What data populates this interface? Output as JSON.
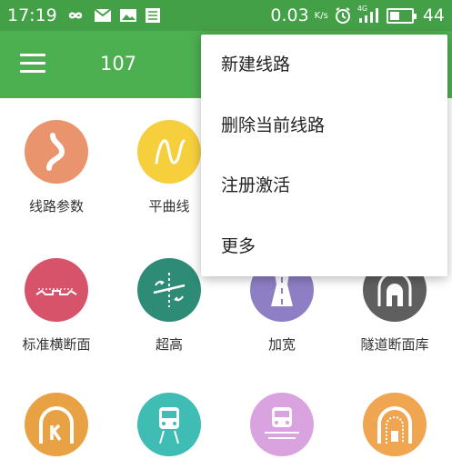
{
  "status_bar": {
    "time": "17:19",
    "speed": "0.03",
    "speed_unit": "K/s",
    "network_label": "4G",
    "battery": "44",
    "battery_fraction": 0.44
  },
  "app_bar": {
    "title": "107"
  },
  "popup_menu": {
    "items": [
      "新建线路",
      "删除当前线路",
      "注册激活",
      "更多"
    ]
  },
  "grid": {
    "items": [
      {
        "label": "线路参数",
        "color": "#e9946c",
        "icon": "road-curve-icon"
      },
      {
        "label": "平曲线",
        "color": "#f6cf3d",
        "icon": "curve-wave-icon"
      },
      {
        "label": "",
        "color": "#7bb9a6",
        "icon": "hidden-icon"
      },
      {
        "label": "",
        "color": "#9c8cc8",
        "icon": "hidden-icon"
      },
      {
        "label": "标准横断面",
        "color": "#d65369",
        "icon": "cross-section-icon"
      },
      {
        "label": "超高",
        "color": "#2e8b75",
        "icon": "superelevation-icon"
      },
      {
        "label": "加宽",
        "color": "#8e7fc4",
        "icon": "road-widen-icon"
      },
      {
        "label": "隧道断面库",
        "color": "#5f5f5f",
        "icon": "tunnel-section-icon"
      },
      {
        "label": "",
        "color": "#e8a244",
        "icon": "tunnel-k-icon"
      },
      {
        "label": "",
        "color": "#3fbcb4",
        "icon": "train-icon"
      },
      {
        "label": "",
        "color": "#d9a3e0",
        "icon": "train-track-icon"
      },
      {
        "label": "",
        "color": "#f0a551",
        "icon": "tunnel-arch-icon"
      }
    ]
  }
}
